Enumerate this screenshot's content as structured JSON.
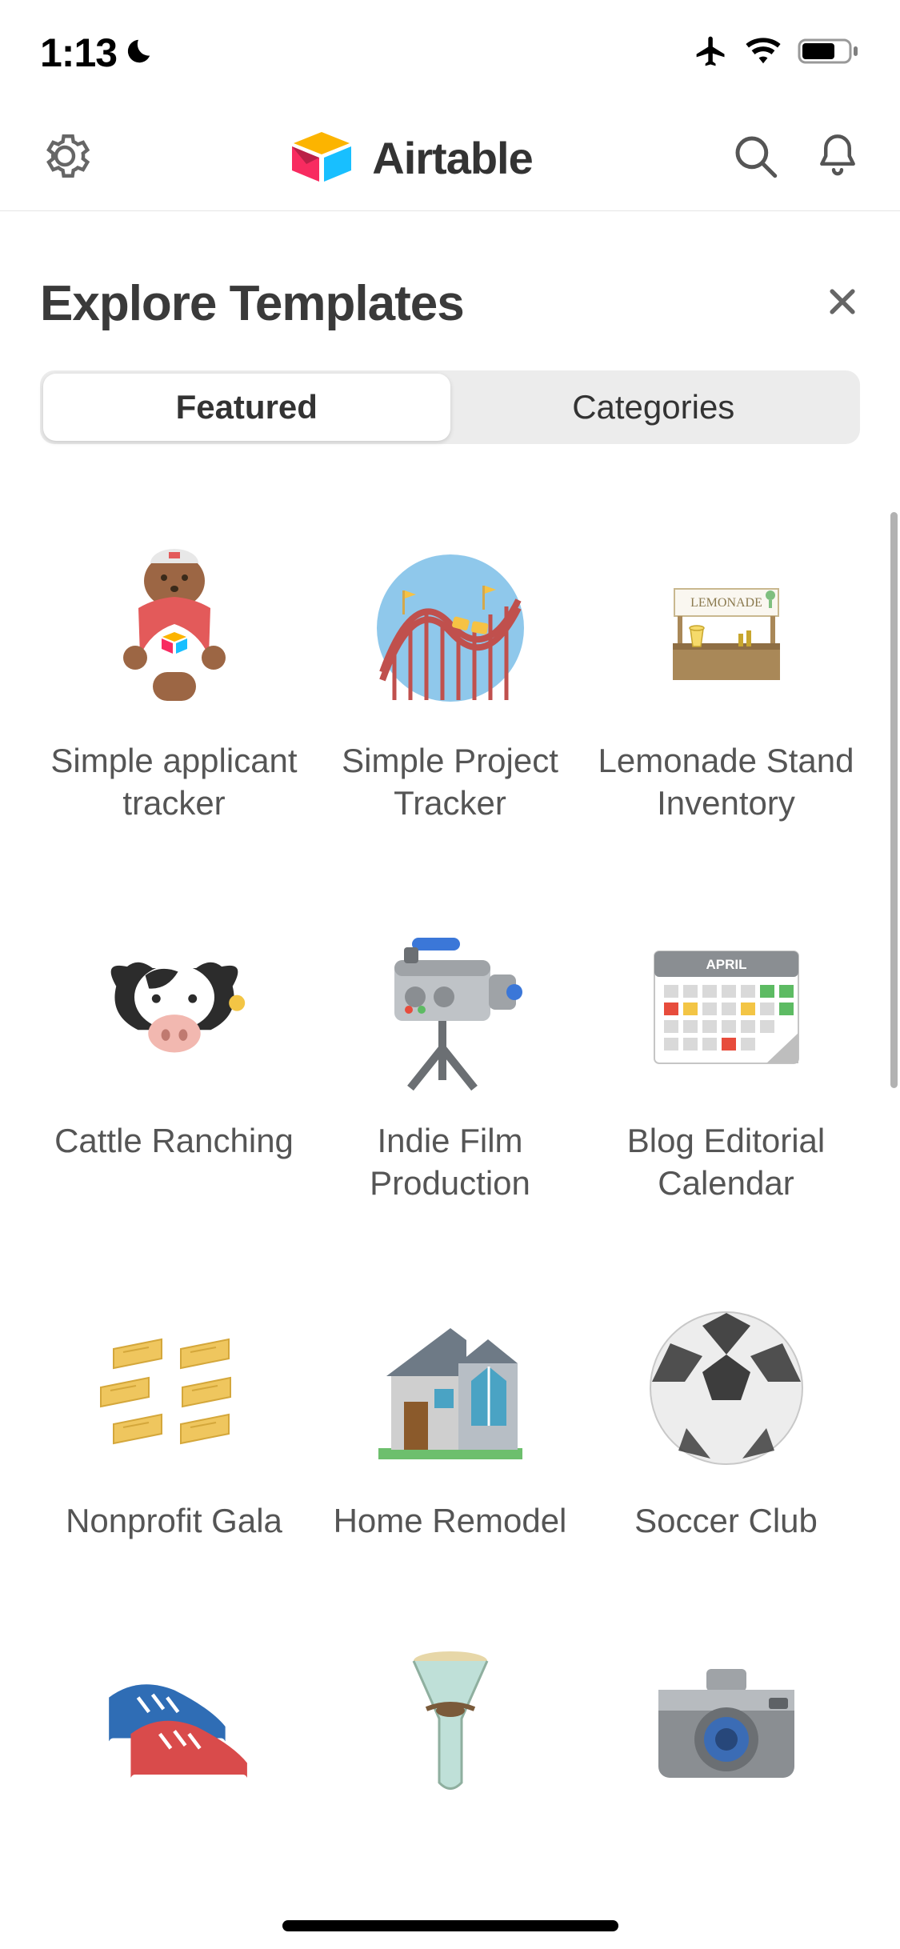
{
  "status": {
    "time": "1:13"
  },
  "header": {
    "brand": "Airtable"
  },
  "page": {
    "title": "Explore Templates",
    "tabs": [
      {
        "label": "Featured",
        "active": true
      },
      {
        "label": "Categories",
        "active": false
      }
    ]
  },
  "templates": [
    {
      "icon": "bear-person-icon",
      "label": "Simple applicant tracker"
    },
    {
      "icon": "roller-coaster-icon",
      "label": "Simple Project Tracker"
    },
    {
      "icon": "lemonade-stand-icon",
      "label": "Lemonade Stand Inventory"
    },
    {
      "icon": "cow-icon",
      "label": "Cattle Ranching"
    },
    {
      "icon": "film-camera-icon",
      "label": "Indie Film Production"
    },
    {
      "icon": "calendar-april-icon",
      "label": "Blog Editorial Calendar"
    },
    {
      "icon": "gold-cards-icon",
      "label": "Nonprofit Gala"
    },
    {
      "icon": "house-icon",
      "label": "Home Remodel"
    },
    {
      "icon": "soccer-ball-icon",
      "label": "Soccer Club"
    },
    {
      "icon": "sneakers-icon",
      "label": ""
    },
    {
      "icon": "carafe-icon",
      "label": ""
    },
    {
      "icon": "photo-camera-icon",
      "label": ""
    }
  ]
}
